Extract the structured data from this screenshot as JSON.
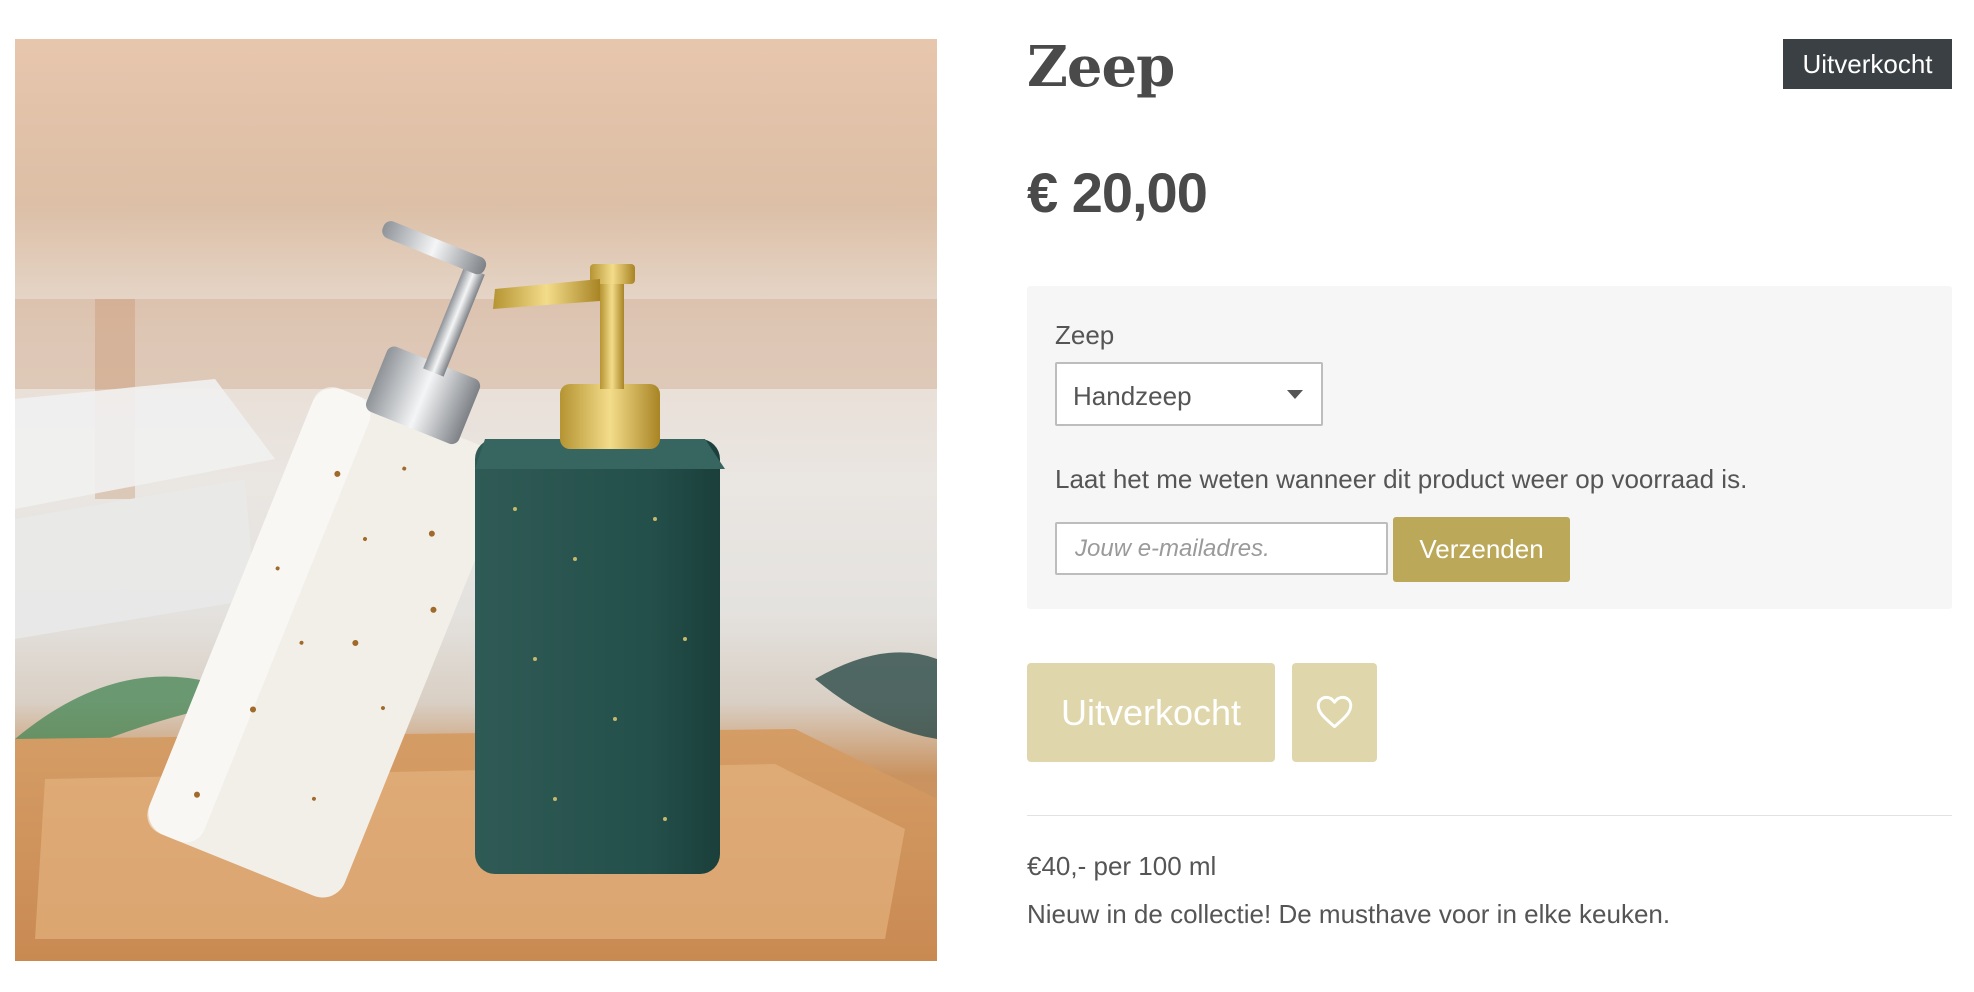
{
  "badge": "Uitverkocht",
  "product": {
    "title": "Zeep",
    "price": "€ 20,00"
  },
  "options": {
    "label": "Zeep",
    "selected": "Handzeep",
    "notify_text": "Laat het me weten wanneer dit product weer op voorraad is.",
    "email_placeholder": "Jouw e-mailadres.",
    "send_label": "Verzenden"
  },
  "actions": {
    "soldout_label": "Uitverkocht",
    "wishlist_icon": "heart-icon"
  },
  "description": {
    "unit_price": "€40,- per 100 ml",
    "text": "Nieuw in de collectie! De musthave voor in elke keuken."
  },
  "colors": {
    "accent": "#bba959",
    "accent_disabled": "#dfd7ab",
    "badge_bg": "#3a4043",
    "panel_bg": "#f6f6f6"
  }
}
